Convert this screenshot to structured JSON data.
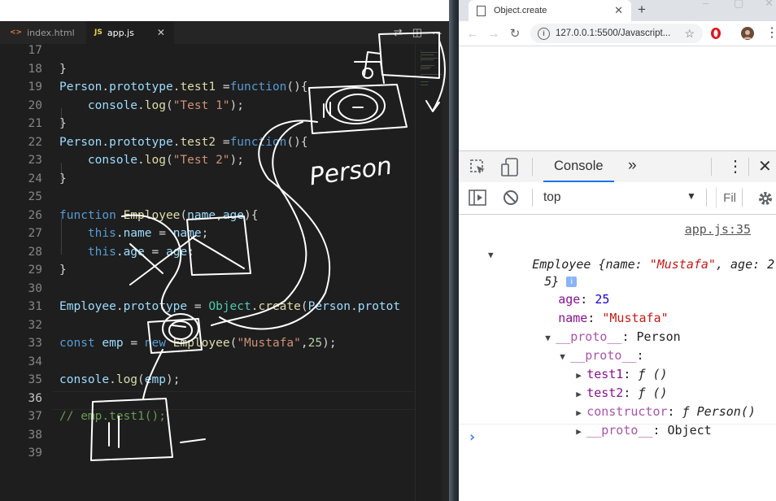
{
  "editor": {
    "tabs": [
      {
        "icon": "<>",
        "label": "index.html"
      },
      {
        "icon": "JS",
        "label": "app.js"
      }
    ],
    "current_line": "36",
    "lines": [
      {
        "n": "17",
        "tokens": []
      },
      {
        "n": "18",
        "tokens": [
          {
            "t": "}",
            "c": "k-p"
          }
        ]
      },
      {
        "n": "19",
        "tokens": [
          {
            "t": "Person",
            "c": "k-prop"
          },
          {
            "t": ".",
            "c": "k-p"
          },
          {
            "t": "prototype",
            "c": "k-prop"
          },
          {
            "t": ".",
            "c": "k-p"
          },
          {
            "t": "test1",
            "c": "k-fn"
          },
          {
            "t": " =",
            "c": "k-p"
          },
          {
            "t": "function",
            "c": "k-kw"
          },
          {
            "t": "(){",
            "c": "k-p"
          }
        ]
      },
      {
        "n": "20",
        "tokens": [
          {
            "t": "    console",
            "c": "k-prop"
          },
          {
            "t": ".",
            "c": "k-p"
          },
          {
            "t": "log",
            "c": "k-fn"
          },
          {
            "t": "(",
            "c": "k-p"
          },
          {
            "t": "\"Test 1\"",
            "c": "k-str"
          },
          {
            "t": ");",
            "c": "k-p"
          }
        ]
      },
      {
        "n": "21",
        "tokens": [
          {
            "t": "}",
            "c": "k-p"
          }
        ]
      },
      {
        "n": "22",
        "tokens": [
          {
            "t": "Person",
            "c": "k-prop"
          },
          {
            "t": ".",
            "c": "k-p"
          },
          {
            "t": "prototype",
            "c": "k-prop"
          },
          {
            "t": ".",
            "c": "k-p"
          },
          {
            "t": "test2",
            "c": "k-fn"
          },
          {
            "t": " =",
            "c": "k-p"
          },
          {
            "t": "function",
            "c": "k-kw"
          },
          {
            "t": "(){",
            "c": "k-p"
          }
        ]
      },
      {
        "n": "23",
        "tokens": [
          {
            "t": "    console",
            "c": "k-prop"
          },
          {
            "t": ".",
            "c": "k-p"
          },
          {
            "t": "log",
            "c": "k-fn"
          },
          {
            "t": "(",
            "c": "k-p"
          },
          {
            "t": "\"Test 2\"",
            "c": "k-str"
          },
          {
            "t": ");",
            "c": "k-p"
          }
        ]
      },
      {
        "n": "24",
        "tokens": [
          {
            "t": "}",
            "c": "k-p"
          }
        ]
      },
      {
        "n": "25",
        "tokens": []
      },
      {
        "n": "26",
        "tokens": [
          {
            "t": "function",
            "c": "k-kw"
          },
          {
            "t": " ",
            "c": "k-p"
          },
          {
            "t": "Employee",
            "c": "k-fn"
          },
          {
            "t": "(",
            "c": "k-p"
          },
          {
            "t": "name",
            "c": "k-prop"
          },
          {
            "t": ",",
            "c": "k-p"
          },
          {
            "t": "age",
            "c": "k-prop"
          },
          {
            "t": "){",
            "c": "k-p"
          }
        ]
      },
      {
        "n": "27",
        "tokens": [
          {
            "t": "    this",
            "c": "k-kw"
          },
          {
            "t": ".",
            "c": "k-p"
          },
          {
            "t": "name",
            "c": "k-prop"
          },
          {
            "t": " = ",
            "c": "k-p"
          },
          {
            "t": "name",
            "c": "k-prop"
          },
          {
            "t": ";",
            "c": "k-p"
          }
        ]
      },
      {
        "n": "28",
        "tokens": [
          {
            "t": "    this",
            "c": "k-kw"
          },
          {
            "t": ".",
            "c": "k-p"
          },
          {
            "t": "age",
            "c": "k-prop"
          },
          {
            "t": " = ",
            "c": "k-p"
          },
          {
            "t": "age",
            "c": "k-prop"
          },
          {
            "t": ";",
            "c": "k-p"
          }
        ]
      },
      {
        "n": "29",
        "tokens": [
          {
            "t": "}",
            "c": "k-p"
          }
        ]
      },
      {
        "n": "30",
        "tokens": []
      },
      {
        "n": "31",
        "tokens": [
          {
            "t": "Employee",
            "c": "k-prop"
          },
          {
            "t": ".",
            "c": "k-p"
          },
          {
            "t": "prototype",
            "c": "k-prop"
          },
          {
            "t": " = ",
            "c": "k-p"
          },
          {
            "t": "Object",
            "c": "k-cls"
          },
          {
            "t": ".",
            "c": "k-p"
          },
          {
            "t": "create",
            "c": "k-fn"
          },
          {
            "t": "(",
            "c": "k-p"
          },
          {
            "t": "Person",
            "c": "k-prop"
          },
          {
            "t": ".",
            "c": "k-p"
          },
          {
            "t": "protot",
            "c": "k-prop"
          }
        ]
      },
      {
        "n": "32",
        "tokens": []
      },
      {
        "n": "33",
        "tokens": [
          {
            "t": "const",
            "c": "k-kw"
          },
          {
            "t": " ",
            "c": "k-p"
          },
          {
            "t": "emp",
            "c": "k-prop"
          },
          {
            "t": " = ",
            "c": "k-p"
          },
          {
            "t": "new",
            "c": "k-kw"
          },
          {
            "t": " ",
            "c": "k-p"
          },
          {
            "t": "Employee",
            "c": "k-fn"
          },
          {
            "t": "(",
            "c": "k-p"
          },
          {
            "t": "\"Mustafa\"",
            "c": "k-str"
          },
          {
            "t": ",",
            "c": "k-p"
          },
          {
            "t": "25",
            "c": "k-num"
          },
          {
            "t": ");",
            "c": "k-p"
          }
        ]
      },
      {
        "n": "34",
        "tokens": []
      },
      {
        "n": "35",
        "tokens": [
          {
            "t": "console",
            "c": "k-prop"
          },
          {
            "t": ".",
            "c": "k-p"
          },
          {
            "t": "log",
            "c": "k-fn"
          },
          {
            "t": "(",
            "c": "k-p"
          },
          {
            "t": "emp",
            "c": "k-prop"
          },
          {
            "t": ");",
            "c": "k-p"
          }
        ]
      },
      {
        "n": "36",
        "tokens": []
      },
      {
        "n": "37",
        "tokens": [
          {
            "t": "// emp.test1();",
            "c": "k-com"
          }
        ]
      },
      {
        "n": "38",
        "tokens": []
      },
      {
        "n": "39",
        "tokens": []
      }
    ],
    "annotation_text": "Person"
  },
  "browser": {
    "tab_title": "Object.create",
    "url": "127.0.0.1:5500/Javascript...",
    "devtools": {
      "tab_console": "Console",
      "more_tabs": "»",
      "context": "top",
      "filter_placeholder": "Fil"
    },
    "console": {
      "source_link": "app.js:35",
      "object_head": "Employee",
      "object_summary_a": " {name: ",
      "object_summary_name": "\"Mustafa\"",
      "object_summary_b": ", age: 2",
      "object_summary_c": "5}",
      "info_badge": "i",
      "age_key": "age",
      "age_val": "25",
      "name_key": "name",
      "name_val": "\"Mustafa\"",
      "proto1_key": "__proto__",
      "proto1_val": ": Person",
      "proto2_key": "__proto__",
      "proto2_val": ":",
      "test1_key": "test1",
      "test1_val": "ƒ ()",
      "test2_key": "test2",
      "test2_val": "ƒ ()",
      "ctor_key": "constructor",
      "ctor_val_a": "ƒ",
      "ctor_val_b": "Person()",
      "proto3_key": "__proto__",
      "proto3_val": ": Object",
      "prompt": "›"
    }
  }
}
